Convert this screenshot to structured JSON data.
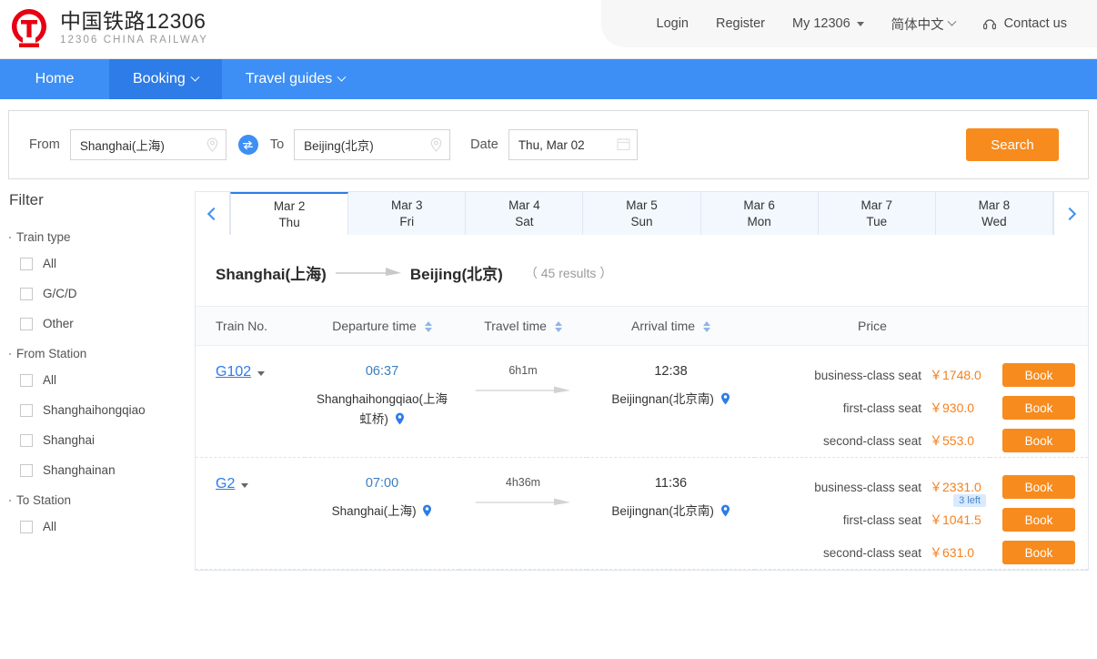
{
  "brand": {
    "cn": "中国铁路12306",
    "en": "12306 CHINA RAILWAY"
  },
  "topnav": [
    {
      "label": "Login",
      "icon": null,
      "caret": false
    },
    {
      "label": "Register",
      "icon": null,
      "caret": false
    },
    {
      "label": "My 12306",
      "icon": null,
      "caret": true
    },
    {
      "label": "简体中文",
      "icon": null,
      "chev": true
    },
    {
      "label": "Contact us",
      "icon": "headset-icon",
      "caret": false
    }
  ],
  "mainnav": [
    {
      "label": "Home",
      "chev": false,
      "active": false
    },
    {
      "label": "Booking",
      "chev": true,
      "active": true
    },
    {
      "label": "Travel guides",
      "chev": true,
      "active": false
    }
  ],
  "search": {
    "from_label": "From",
    "from_value": "Shanghai(上海)",
    "to_label": "To",
    "to_value": "Beijing(北京)",
    "date_label": "Date",
    "date_value": "Thu, Mar 02",
    "swap_icon": "swap-icon",
    "button": "Search"
  },
  "sidebar": {
    "title": "Filter",
    "groups": [
      {
        "title": "Train type",
        "options": [
          "All",
          "G/C/D",
          "Other"
        ]
      },
      {
        "title": "From Station",
        "options": [
          "All",
          "Shanghaihongqiao",
          "Shanghai",
          "Shanghainan"
        ]
      },
      {
        "title": "To Station",
        "options": [
          "All"
        ]
      }
    ]
  },
  "datetabs": {
    "prev_icon": "chevron-left-icon",
    "next_icon": "chevron-right-icon",
    "items": [
      {
        "date": "Mar 2",
        "day": "Thu",
        "active": true
      },
      {
        "date": "Mar 3",
        "day": "Fri",
        "active": false
      },
      {
        "date": "Mar 4",
        "day": "Sat",
        "active": false
      },
      {
        "date": "Mar 5",
        "day": "Sun",
        "active": false
      },
      {
        "date": "Mar 6",
        "day": "Mon",
        "active": false
      },
      {
        "date": "Mar 7",
        "day": "Tue",
        "active": false
      },
      {
        "date": "Mar 8",
        "day": "Wed",
        "active": false
      }
    ]
  },
  "route": {
    "from": "Shanghai(上海)",
    "to": "Beijing(北京)",
    "results": "（ 45 results ）"
  },
  "table": {
    "headers": [
      "Train No.",
      "Departure time",
      "Travel time",
      "Arrival time",
      "Price"
    ],
    "rows": [
      {
        "train_no": "G102",
        "depart_time": "06:37",
        "depart_station": "Shanghaihongqiao(上海虹桥)",
        "duration": "6h1m",
        "arrive_time": "12:38",
        "arrive_station": "Beijingnan(北京南)",
        "prices": [
          {
            "name": "business-class seat",
            "value": "￥1748.0",
            "badge": null,
            "book": "Book"
          },
          {
            "name": "first-class seat",
            "value": "￥930.0",
            "badge": null,
            "book": "Book"
          },
          {
            "name": "second-class seat",
            "value": "￥553.0",
            "badge": null,
            "book": "Book"
          }
        ]
      },
      {
        "train_no": "G2",
        "depart_time": "07:00",
        "depart_station": "Shanghai(上海)",
        "duration": "4h36m",
        "arrive_time": "11:36",
        "arrive_station": "Beijingnan(北京南)",
        "prices": [
          {
            "name": "business-class seat",
            "value": "￥2331.0",
            "badge": "3 left",
            "book": "Book"
          },
          {
            "name": "first-class seat",
            "value": "￥1041.5",
            "badge": null,
            "book": "Book"
          },
          {
            "name": "second-class seat",
            "value": "￥631.0",
            "badge": null,
            "book": "Book"
          }
        ]
      }
    ]
  },
  "colors": {
    "brand_red": "#e60012",
    "nav_blue": "#3d8ff5",
    "nav_active": "#2d7ce8",
    "accent_orange": "#f78b1e",
    "price_orange": "#f58220",
    "badge_bg": "#d9eaff"
  }
}
